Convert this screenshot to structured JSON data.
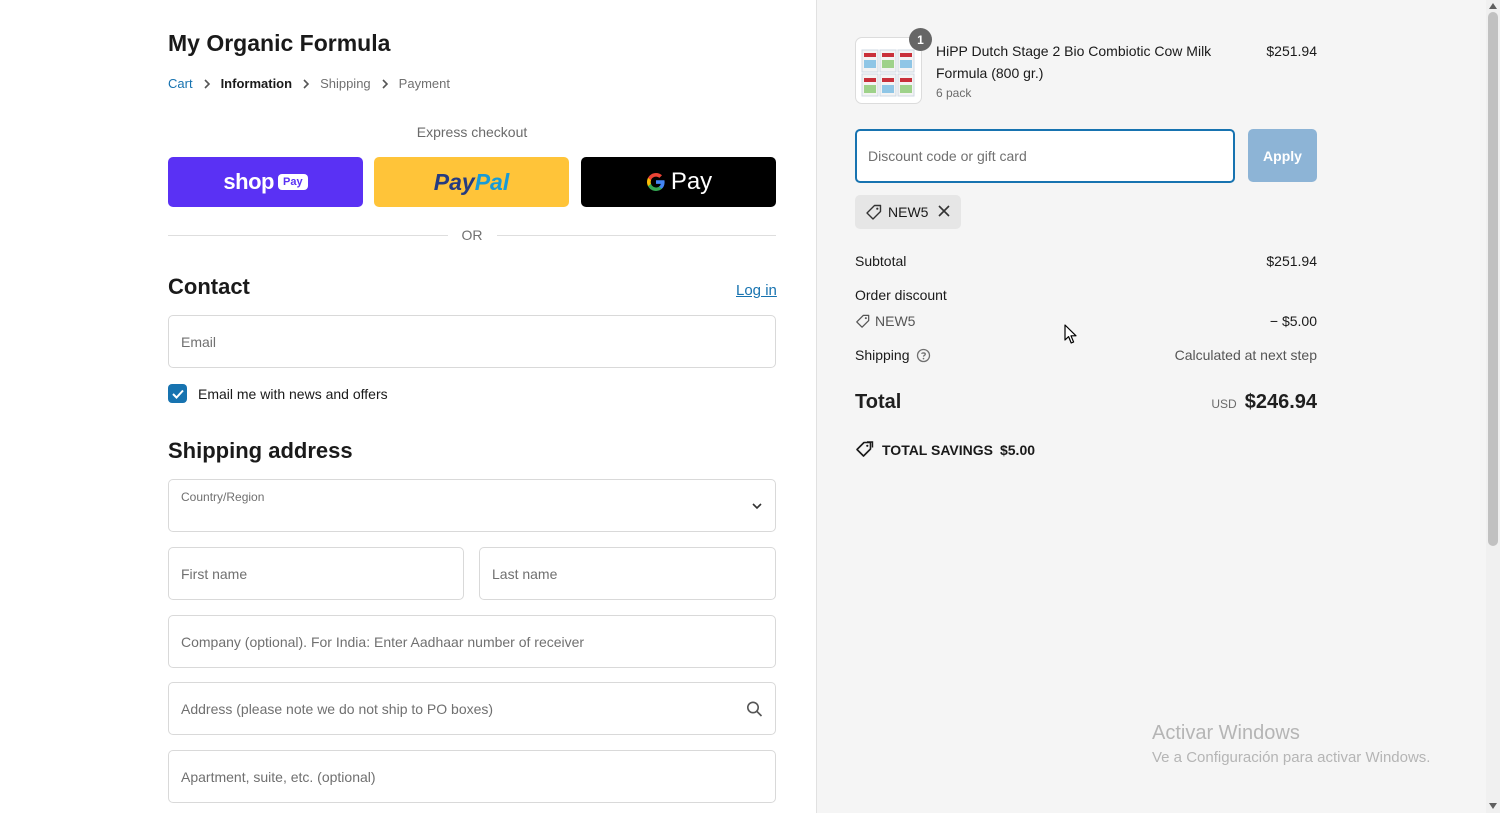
{
  "store": {
    "title": "My Organic Formula"
  },
  "breadcrumb": {
    "cart": "Cart",
    "information": "Information",
    "shipping": "Shipping",
    "payment": "Payment"
  },
  "express": {
    "label": "Express checkout",
    "shop_text": "shop",
    "shop_pill": "Pay",
    "paypal_part1": "Pay",
    "paypal_part2": "Pal",
    "gpay_text": "Pay"
  },
  "divider": {
    "or": "OR"
  },
  "contact": {
    "heading": "Contact",
    "login": "Log in",
    "email_placeholder": "Email",
    "news_checkbox_label": "Email me with news and offers",
    "news_checked": true
  },
  "shipping_address": {
    "heading": "Shipping address",
    "country_label": "Country/Region",
    "first_name_placeholder": "First name",
    "last_name_placeholder": "Last name",
    "company_placeholder": "Company (optional). For India: Enter Aadhaar number of receiver",
    "address_placeholder": "Address (please note we do not ship to PO boxes)",
    "apartment_placeholder": "Apartment, suite, etc. (optional)"
  },
  "order": {
    "product": {
      "name": "HiPP Dutch Stage 2 Bio Combiotic Cow Milk Formula (800 gr.)",
      "variant": "6 pack",
      "price": "$251.94",
      "quantity": "1"
    },
    "discount_placeholder": "Discount code or gift card",
    "apply_label": "Apply",
    "applied_code": "NEW5",
    "subtotal_label": "Subtotal",
    "subtotal_value": "$251.94",
    "order_discount_label": "Order discount",
    "discount_code": "NEW5",
    "discount_value": "− $5.00",
    "shipping_label": "Shipping",
    "shipping_value": "Calculated at next step",
    "total_label": "Total",
    "total_currency": "USD",
    "total_value": "$246.94",
    "savings_label": "TOTAL SAVINGS",
    "savings_value": "$5.00"
  },
  "watermark": {
    "line1": "Activar Windows",
    "line2": "Ve a Configuración para activar Windows."
  },
  "colors": {
    "accent": "#1773b0",
    "shop_pay": "#5a31f4",
    "paypal": "#ffc439",
    "gpay": "#000000",
    "apply_disabled": "#8db4d6",
    "summary_bg": "#f5f5f5"
  }
}
